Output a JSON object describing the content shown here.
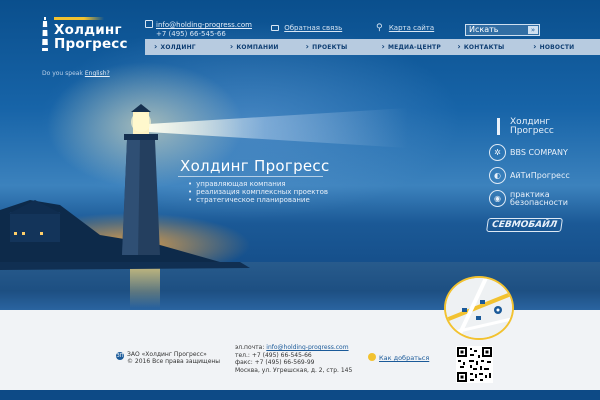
{
  "header": {
    "logo_line1": "Холдинг",
    "logo_line2": "Прогресс",
    "do_you_speak": "Do you speak",
    "english_link": "English?",
    "email": "info@holding-progress.com",
    "phone": "+7 (495) 66-545-66",
    "feedback_label": "Обратная связь",
    "sitemap_label": "Карта сайта",
    "search_value": "Искать"
  },
  "nav": {
    "items": [
      {
        "label": "ХОЛДИНГ"
      },
      {
        "label": "КОМПАНИИ"
      },
      {
        "label": "ПРОЕКТЫ"
      },
      {
        "label": "МЕДИА-ЦЕНТР"
      },
      {
        "label": "КОНТАКТЫ"
      },
      {
        "label": "НОВОСТИ"
      }
    ]
  },
  "hero": {
    "title": "Холдинг Прогресс",
    "bullets": [
      "управляющая компания",
      "реализация комплексных проектов",
      "стратегическое планирование"
    ]
  },
  "partners": {
    "p1_line1": "Холдинг",
    "p1_line2": "Прогресс",
    "p2": "BBS COMPANY",
    "p3": "АйТиПрогресс",
    "p4_line1": "практика",
    "p4_line2": "безопасности",
    "p5": "СЕВМОБАЙЛ"
  },
  "footer": {
    "company": "ЗАО «Холдинг Прогресс»",
    "rights": "© 2016 Все права защищены",
    "email_label": "эл.почта:",
    "email": "info@holding-progress.com",
    "tel": "тел.: +7 (495) 66-545-66",
    "fax": "факс: +7 (495) 66-569-99",
    "address": "Москва, ул. Угрешская, д. 2, стр. 145",
    "how_to_get": "Как добраться"
  },
  "colors": {
    "accent": "#f2c230",
    "brand": "#1b5a99",
    "nav_bg": "#b7cbe0"
  }
}
